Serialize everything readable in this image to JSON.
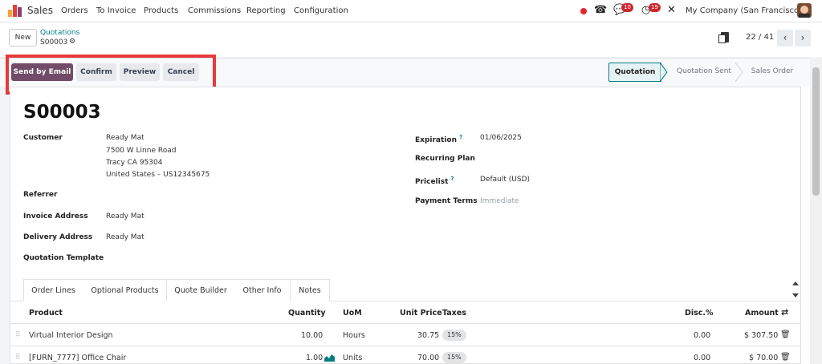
{
  "app": {
    "name": "Sales"
  },
  "nav_menu": [
    "Orders",
    "To Invoice",
    "Products",
    "Commissions",
    "Reporting",
    "Configuration"
  ],
  "systray": {
    "discuss_count": "10",
    "activity_count": "19",
    "company": "My Company (San Francisco)"
  },
  "control_panel": {
    "new_label": "New",
    "breadcrumb_parent": "Quotations",
    "record_ref": "S00003",
    "pager": "22 / 41"
  },
  "actions": [
    "Send by Email",
    "Confirm",
    "Preview",
    "Cancel"
  ],
  "status_steps": [
    "Quotation",
    "Quotation Sent",
    "Sales Order"
  ],
  "status_current": "Quotation",
  "record": {
    "name": "S00003",
    "left_fields": [
      {
        "label": "Customer",
        "lines": [
          "Ready Mat",
          "7500 W Linne Road",
          "Tracy CA 95304",
          "United States – US12345675"
        ]
      },
      {
        "label": "Referrer",
        "lines": []
      },
      {
        "label": "Invoice Address",
        "lines": [
          "Ready Mat"
        ]
      },
      {
        "label": "Delivery Address",
        "lines": [
          "Ready Mat"
        ]
      },
      {
        "label": "Quotation Template",
        "lines": []
      }
    ],
    "right_fields": [
      {
        "label": "Expiration",
        "value": "01/06/2025",
        "help": "?"
      },
      {
        "label": "Recurring Plan",
        "value": ""
      },
      {
        "label": "Pricelist",
        "value": "Default (USD)",
        "help": "?"
      },
      {
        "label": "Payment Terms",
        "value": "Immediate",
        "placeholder": true
      }
    ]
  },
  "tabs": [
    "Order Lines",
    "Optional Products",
    "Quote Builder",
    "Other Info",
    "Notes"
  ],
  "table": {
    "columns": [
      "Product",
      "Quantity",
      "UoM",
      "Unit Price",
      "Taxes",
      "Disc.%",
      "Amount"
    ],
    "rows": [
      {
        "product": "Virtual Interior Design",
        "quantity": "10.00",
        "uom": "Hours",
        "unit_price": "30.75",
        "tax": "15%",
        "disc": "0.00",
        "amount": "$ 307.50"
      },
      {
        "product": "[FURN_7777] Office Chair",
        "quantity": "1.00",
        "uom": "Units",
        "unit_price": "70.00",
        "tax": "15%",
        "disc": "0.00",
        "amount": "$ 70.00"
      }
    ]
  },
  "colors": {
    "primary": "#714b67",
    "accent": "#017e84",
    "highlight_red": "#e63a3a"
  }
}
